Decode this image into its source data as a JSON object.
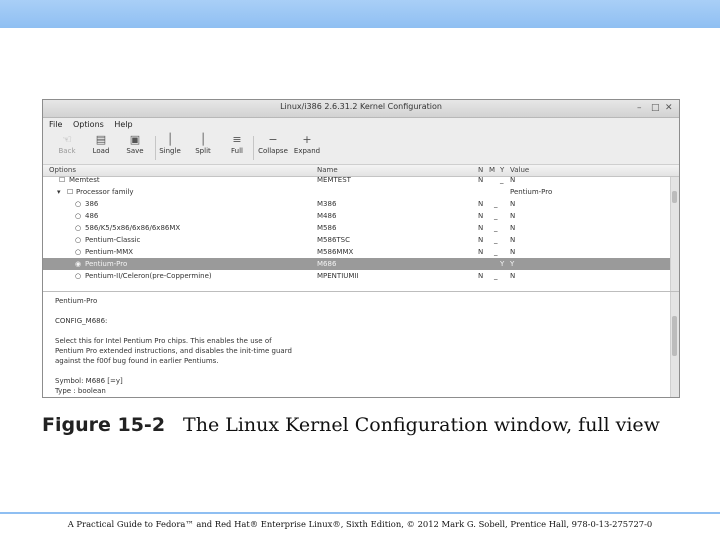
{
  "window": {
    "title": "Linux/i386 2.6.31.2 Kernel Configuration",
    "controls": {
      "minimize": "–",
      "maximize": "□",
      "close": "✕"
    }
  },
  "menu": [
    "File",
    "Options",
    "Help"
  ],
  "toolbar": {
    "back": "Back",
    "load": "Load",
    "save": "Save",
    "single": "Single",
    "split": "Split",
    "full": "Full",
    "collapse": "Collapse",
    "expand": "Expand"
  },
  "tree": {
    "columns": {
      "options": "Options",
      "name": "Name",
      "n": "N",
      "m": "M",
      "y": "Y",
      "value": "Value"
    },
    "rows": [
      {
        "label": "Memtest",
        "name": "MEMTEST",
        "n": "N",
        "m": "",
        "y": "_",
        "value": "N"
      },
      {
        "label": "Processor family",
        "name": "",
        "n": "",
        "m": "",
        "y": "",
        "value": "Pentium-Pro"
      },
      {
        "label": "386",
        "name": "M386",
        "n": "N",
        "m": "",
        "y": "_",
        "value": "N"
      },
      {
        "label": "486",
        "name": "M486",
        "n": "N",
        "m": "",
        "y": "_",
        "value": "N"
      },
      {
        "label": "586/K5/5x86/6x86/6x86MX",
        "name": "M586",
        "n": "N",
        "m": "",
        "y": "_",
        "value": "N"
      },
      {
        "label": "Pentium-Classic",
        "name": "M586TSC",
        "n": "N",
        "m": "",
        "y": "_",
        "value": "N"
      },
      {
        "label": "Pentium-MMX",
        "name": "M586MMX",
        "n": "N",
        "m": "",
        "y": "_",
        "value": "N"
      },
      {
        "label": "Pentium-Pro",
        "name": "M686",
        "n": "",
        "m": "",
        "y": "Y",
        "value": "Y"
      },
      {
        "label": "Pentium-II/Celeron(pre-Coppermine)",
        "name": "MPENTIUMII",
        "n": "N",
        "m": "",
        "y": "_",
        "value": "N"
      }
    ]
  },
  "help": {
    "title": "Pentium-Pro",
    "config": "CONFIG_M686:",
    "lines": [
      "Select this for Intel Pentium Pro chips. This enables the use of",
      "Pentium Pro extended instructions, and disables the init-time guard",
      "against the f00f bug found in earlier Pentiums."
    ],
    "symbol": "Symbol: M686 [=y]",
    "type": "Type : boolean"
  },
  "caption": {
    "figure": "Figure 15-2",
    "text": "The Linux Kernel Configuration window, full view"
  },
  "footer": "A Practical Guide to Fedora™ and Red Hat® Enterprise Linux®, Sixth Edition, © 2012 Mark G. Sobell, Prentice Hall, 978-0-13-275727-0"
}
